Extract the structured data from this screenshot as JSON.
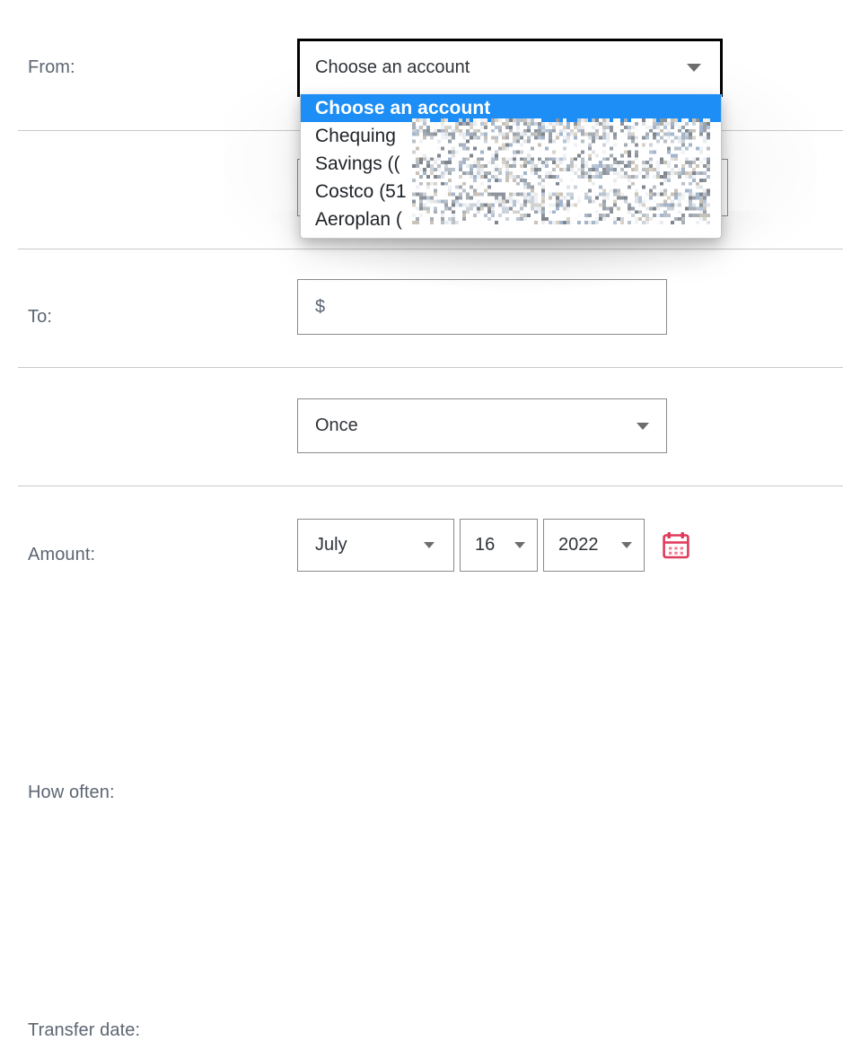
{
  "form": {
    "rows": [
      {
        "key": "from",
        "label": "From:",
        "control": "select",
        "value": "Choose an account",
        "state": "focused-open"
      },
      {
        "key": "to",
        "label": "To:",
        "control": "select",
        "value": "",
        "state": "obscured-by-dropdown"
      },
      {
        "key": "amount",
        "label": "Amount:",
        "control": "text-input",
        "placeholder": "$",
        "value": ""
      },
      {
        "key": "how_often",
        "label": "How often:",
        "control": "select",
        "value": "Once"
      },
      {
        "key": "transfer_date",
        "label": "Transfer date:",
        "control": "date-group"
      }
    ]
  },
  "from_dropdown": {
    "open": true,
    "selected_index": 0,
    "options": [
      "Choose an account",
      "Chequing",
      "Savings ((",
      "Costco (51",
      "Aeroplan ("
    ],
    "redacted": true,
    "highlight_color": "#1c8ef5",
    "highlight_text_color": "#ffffff"
  },
  "transfer_date": {
    "month": "July",
    "day": "16",
    "year": "2022",
    "calendar_icon": "calendar-icon",
    "calendar_icon_color": "#e03a5c"
  },
  "icons": {
    "caret": "chevron-down-icon",
    "calendar": "calendar-icon"
  },
  "colors": {
    "label": "#5d6672",
    "border": "#8b8b8b",
    "focus_border": "#000000",
    "divider": "#c9c9c9",
    "accent_blue": "#1c8ef5",
    "calendar_red": "#e03a5c",
    "background": "#ffffff"
  }
}
